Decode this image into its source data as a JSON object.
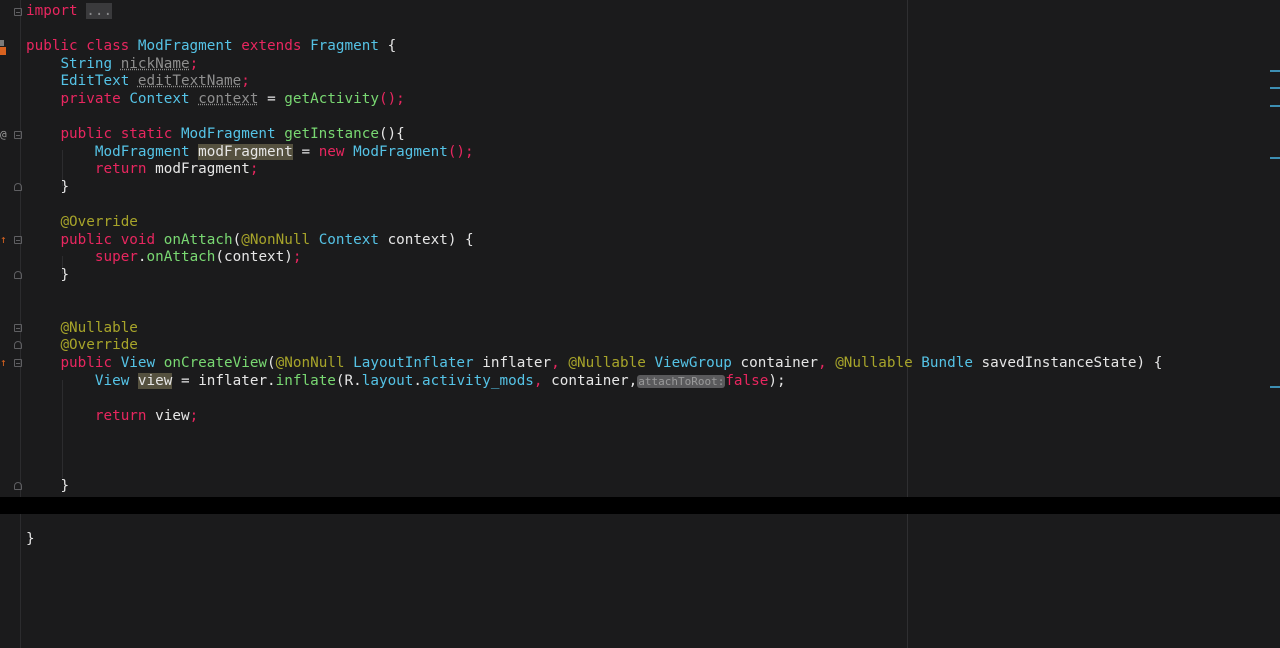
{
  "editor": {
    "lines": {
      "l1": {
        "kw": "import",
        "folded": "..."
      },
      "l3": {
        "kw": "public class",
        "name": "ModFragment",
        "ext": "extends",
        "parent": "Fragment",
        "brace": "{"
      },
      "l4": {
        "type": "String",
        "field": "nickName",
        "semi": ";"
      },
      "l5": {
        "type": "EditText",
        "field": "editTextName",
        "semi": ";"
      },
      "l6": {
        "kw": "private",
        "type": "Context",
        "field": "context",
        "eq": "=",
        "call": "getActivity",
        "tail": "();"
      },
      "l8": {
        "kw": "public static",
        "type": "ModFragment",
        "method": "getInstance",
        "tail": "(){"
      },
      "l9": {
        "type": "ModFragment",
        "var": "modFragment",
        "eq": "=",
        "kw_new": "new",
        "ctor": "ModFragment",
        "tail": "();"
      },
      "l10": {
        "kw": "return",
        "val": "modFragment",
        "semi": ";"
      },
      "l11": {
        "brace": "}"
      },
      "l13": {
        "annotation": "@Override"
      },
      "l14": {
        "kw": "public void",
        "method": "onAttach",
        "open": "(",
        "ann": "@NonNull",
        "type": "Context",
        "param": "context",
        "close": ") {"
      },
      "l15": {
        "kw": "super",
        "dot": ".",
        "method": "onAttach",
        "args": "(context)",
        "semi": ";"
      },
      "l16": {
        "brace": "}"
      },
      "l19": {
        "annotation": "@Nullable"
      },
      "l20": {
        "annotation": "@Override"
      },
      "l21": {
        "kw": "public",
        "type": "View",
        "method": "onCreateView",
        "open": "(",
        "ann1": "@NonNull",
        "type1": "LayoutInflater",
        "param1": "inflater",
        "comma1": ",",
        "ann2": "@Nullable",
        "type2": "ViewGroup",
        "param2": "container",
        "comma2": ",",
        "ann3": "@Nullable",
        "type3": "Bundle",
        "param3": "savedInstanceState",
        "close": ") {"
      },
      "l22": {
        "type": "View",
        "var": "view",
        "eq": "=",
        "obj": "inflater.",
        "method": "inflate",
        "open": "(",
        "r": "R",
        "dot1": ".",
        "layout": "layout",
        "dot2": ".",
        "res": "activity_mods",
        "comma1": ",",
        "arg2": "container",
        "comma2": ",",
        "hint": "attachToRoot:",
        "bool": "false",
        "close": ");"
      },
      "l24": {
        "kw": "return",
        "val": "view",
        "semi": ";"
      },
      "l28": {
        "brace": "}"
      },
      "l31": {
        "brace": "}"
      }
    },
    "gutter_icons": {
      "bookmark": "bookmark-icon",
      "override_marker": "override-icon",
      "implements_marker": "implements-up-arrow-icon",
      "fold": "fold-toggle-icon"
    },
    "colors": {
      "background": "#1b1b1c",
      "keyword": "#e8265f",
      "type": "#55c3e6",
      "annotation": "#a7a42a",
      "method": "#79d872",
      "text": "#e6e6e6",
      "current_line": "#000000",
      "scrollbar_mark": "#3d8fb3"
    }
  }
}
